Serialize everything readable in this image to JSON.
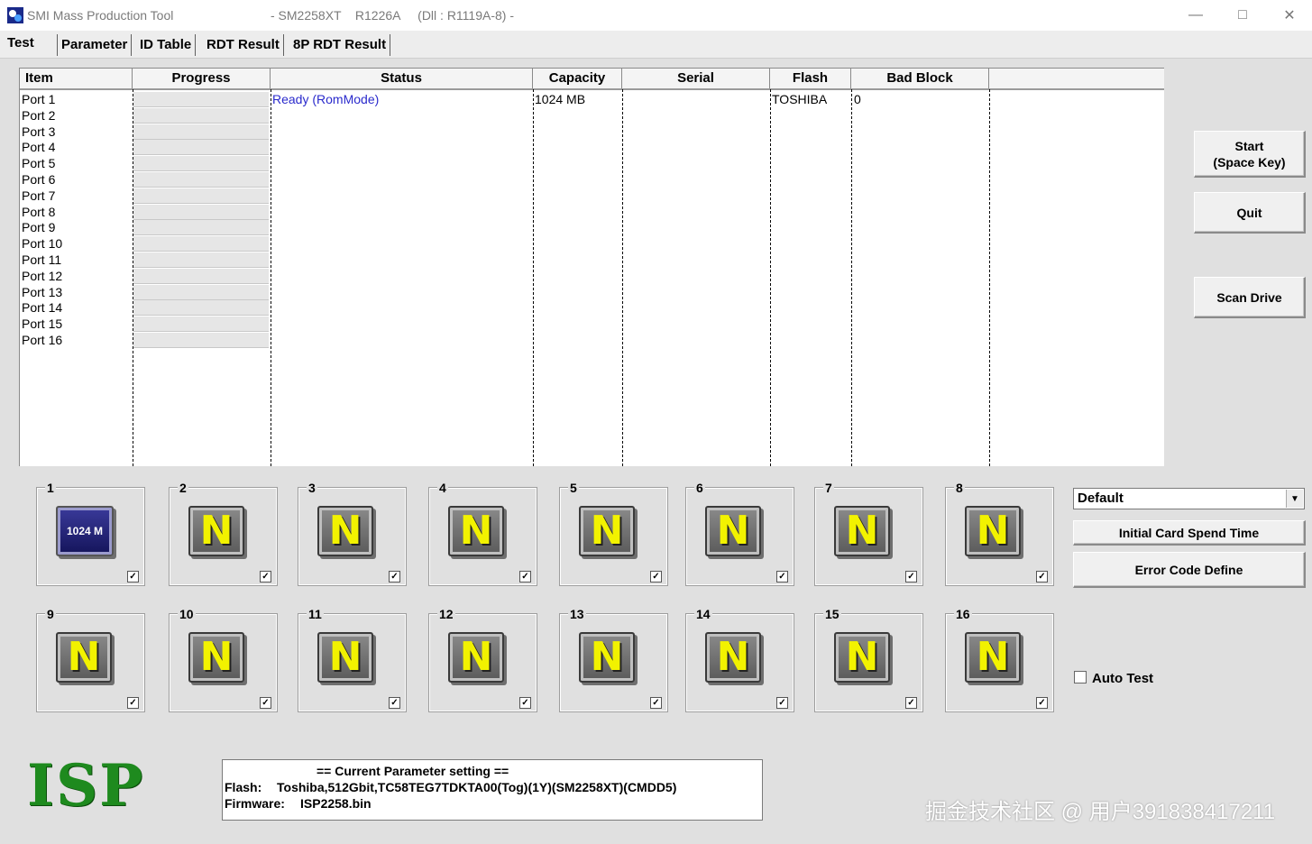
{
  "window": {
    "title": "SMI Mass Production Tool",
    "subtitle": "- SM2258XT    R1226A     (Dll : R1119A-8) -"
  },
  "tabs": [
    "Test",
    "Parameter",
    "ID Table",
    "RDT Result",
    "8P RDT Result"
  ],
  "grid": {
    "headers": [
      "Item",
      "Progress",
      "Status",
      "Capacity",
      "Serial",
      "Flash",
      "Bad Block"
    ],
    "ports": [
      "Port 1",
      "Port 2",
      "Port 3",
      "Port 4",
      "Port 5",
      "Port 6",
      "Port 7",
      "Port 8",
      "Port 9",
      "Port 10",
      "Port 11",
      "Port 12",
      "Port 13",
      "Port 14",
      "Port 15",
      "Port 16"
    ],
    "row1": {
      "status": "Ready (RomMode)",
      "capacity": "1024 MB",
      "flash": "TOSHIBA",
      "bad_block": "0"
    },
    "status_color": "#2a2acc"
  },
  "buttons": {
    "start_line1": "Start",
    "start_line2": "(Space Key)",
    "quit": "Quit",
    "scan": "Scan Drive",
    "initial_card": "Initial Card Spend Time",
    "error_code": "Error Code Define"
  },
  "combo": {
    "value": "Default"
  },
  "auto_test": {
    "label": "Auto Test",
    "checked": false
  },
  "slots": [
    {
      "num": "1",
      "icon": "1024 M"
    },
    {
      "num": "2",
      "icon": "N"
    },
    {
      "num": "3",
      "icon": "N"
    },
    {
      "num": "4",
      "icon": "N"
    },
    {
      "num": "5",
      "icon": "N"
    },
    {
      "num": "6",
      "icon": "N"
    },
    {
      "num": "7",
      "icon": "N"
    },
    {
      "num": "8",
      "icon": "N"
    },
    {
      "num": "9",
      "icon": "N"
    },
    {
      "num": "10",
      "icon": "N"
    },
    {
      "num": "11",
      "icon": "N"
    },
    {
      "num": "12",
      "icon": "N"
    },
    {
      "num": "13",
      "icon": "N"
    },
    {
      "num": "14",
      "icon": "N"
    },
    {
      "num": "15",
      "icon": "N"
    },
    {
      "num": "16",
      "icon": "N"
    }
  ],
  "isp": "ISP",
  "param": {
    "heading": "== Current Parameter setting ==",
    "flash_label": "Flash:",
    "flash_value": "Toshiba,512Gbit,TC58TEG7TDKTA00(Tog)(1Y)(SM2258XT)(CMDD5)",
    "firmware_label": "Firmware:",
    "firmware_value": "ISP2258.bin"
  },
  "watermark": "掘金技术社区 @ 用户391838417211"
}
